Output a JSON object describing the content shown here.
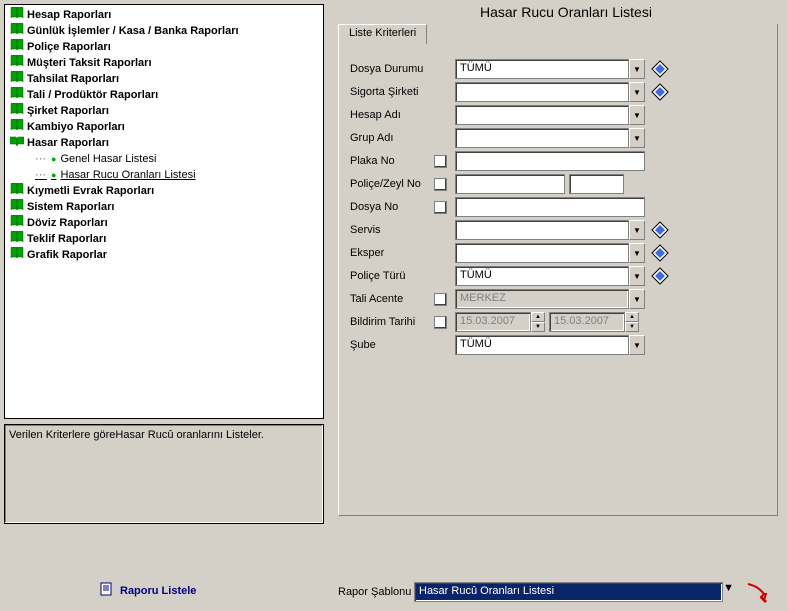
{
  "title": "Hasar Rucu Oranları Listesi",
  "tab_label": "Liste Kriterleri",
  "tree": {
    "items": [
      "Hesap Raporları",
      "Günlük İşlemler / Kasa / Banka Raporları",
      "Poliçe Raporları",
      "Müşteri Taksit Raporları",
      "Tahsilat Raporları",
      "Tali / Prodüktör Raporları",
      "Şirket Raporları",
      "Kambiyo Raporları",
      "Hasar Raporları"
    ],
    "subitems": [
      "Genel Hasar Listesi",
      "Hasar Rucu Oranları Listesi"
    ],
    "items2": [
      "Kıymetli Evrak Raporları",
      "Sistem Raporları",
      "Döviz Raporları",
      "Teklif Raporları",
      "Grafik Raporlar"
    ]
  },
  "description": "Verilen Kriterlere göreHasar Rucû oranlarını Listeler.",
  "form": {
    "dosya_durumu": {
      "label": "Dosya Durumu",
      "value": "TÜMÜ"
    },
    "sigorta_sirketi": {
      "label": "Sigorta Şirketi",
      "value": ""
    },
    "hesap_adi": {
      "label": "Hesap Adı",
      "value": ""
    },
    "grup_adi": {
      "label": "Grup Adı",
      "value": ""
    },
    "plaka_no": {
      "label": "Plaka No",
      "value": ""
    },
    "police_zeyl": {
      "label": "Poliçe/Zeyl No",
      "value1": "",
      "value2": ""
    },
    "dosya_no": {
      "label": "Dosya No",
      "value": ""
    },
    "servis": {
      "label": "Servis",
      "value": ""
    },
    "eksper": {
      "label": "Eksper",
      "value": ""
    },
    "police_turu": {
      "label": "Poliçe Türü",
      "value": "TÜMÜ"
    },
    "tali_acente": {
      "label": "Tali Acente",
      "value": "MERKEZ"
    },
    "bildirim": {
      "label": "Bildirim Tarihi",
      "from": "15.03.2007",
      "to": "15.03.2007"
    },
    "sube": {
      "label": "Şube",
      "value": "TÜMÜ"
    }
  },
  "report_button": "Raporu Listele",
  "template_label": "Rapor Şablonu",
  "template_value": "Hasar Rucû Oranları Listesi"
}
